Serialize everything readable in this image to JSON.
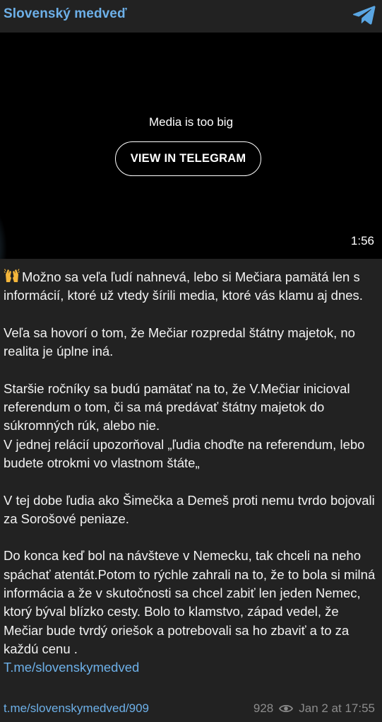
{
  "channel": {
    "name": "Slovenský medveď",
    "logo_icon": "telegram-logo-icon",
    "accent_color": "#6db0e8"
  },
  "media": {
    "message": "Media is too big",
    "button_label": "VIEW IN TELEGRAM",
    "duration": "1:56"
  },
  "post": {
    "emoji_icon": "raising-hands-emoji-icon",
    "paragraphs": [
      "Možno sa veľa ľudí nahnevá, lebo si Mečiara pamätá len s informácií, ktoré už vtedy šírili media, ktoré vás klamu aj dnes.",
      "Veľa sa hovorí o tom, že Mečiar rozpredal štátny majetok, no realita je úplne iná.",
      "Staršie ročníky sa budú pamätať na to, že V.Mečiar inicioval referendum o tom, či sa má predávať štátny majetok do súkromných rúk, alebo nie.",
      "V jednej relácií upozorňoval „ľudia choďte na referendum, lebo budete otrokmi vo vlastnom štáte„",
      "V tej dobe ľudia ako Šimečka a Demeš proti nemu tvrdo bojovali za Sorošové peniaze.",
      "Do konca keď bol na návšteve v Nemecku, tak chceli na neho spáchať atentát.Potom to rýchle zahrali na to, že to bola si milná informácia a že v skutočnosti sa chcel zabiť len jeden Nemec, ktorý býval blízko cesty. Bolo to klamstvo, západ vedel, že Mečiar bude tvrdý oriešok a potrebovali sa ho zbaviť a to za každú cenu ."
    ],
    "channel_link": "T.me/slovenskymedved"
  },
  "footer": {
    "post_link": "t.me/slovenskymedved/909",
    "views": "928",
    "views_icon": "eye-icon",
    "date": "Jan 2 at 17:55"
  }
}
